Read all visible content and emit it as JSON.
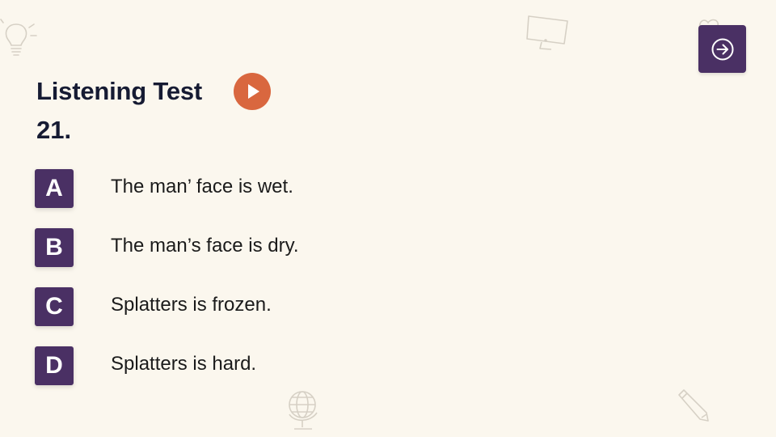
{
  "colors": {
    "background": "#fbf7ee",
    "accent_purple": "#4a3064",
    "play_orange": "#d9673f",
    "title_text": "#161b33"
  },
  "header": {
    "title": "Listening Test",
    "question_number": "21."
  },
  "controls": {
    "play_icon": "play-icon",
    "next_icon": "arrow-right-circle-icon"
  },
  "options": [
    {
      "letter": "A",
      "text": "The man’ face is wet."
    },
    {
      "letter": "B",
      "text": "The man’s face is dry."
    },
    {
      "letter": "C",
      "text": "Splatters is frozen."
    },
    {
      "letter": "D",
      "text": "Splatters is hard."
    }
  ],
  "decorations": [
    "lightbulb-icon",
    "monitor-icon",
    "heart-icon",
    "globe-icon",
    "pencil-icon"
  ]
}
